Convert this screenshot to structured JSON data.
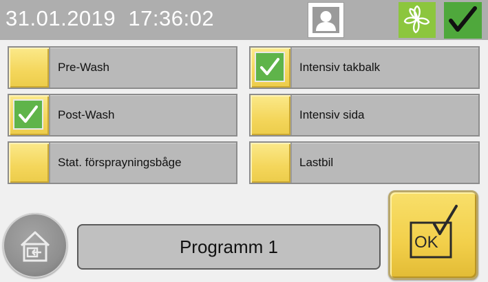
{
  "header": {
    "date": "31.01.2019",
    "time": "17:36:02",
    "user_icon": "user-icon",
    "logo_icon": "flower-logo-icon",
    "status_icon": "checkmark-icon"
  },
  "options": [
    {
      "label": "Pre-Wash",
      "checked": false
    },
    {
      "label": "Post-Wash",
      "checked": true
    },
    {
      "label": "Stat. försprayningsbåge",
      "checked": false
    },
    {
      "label": "Intensiv takbalk",
      "checked": true
    },
    {
      "label": "Intensiv sida",
      "checked": false
    },
    {
      "label": "Lastbil",
      "checked": false
    }
  ],
  "program": {
    "name": "Programm 1"
  },
  "ok_button": {
    "label": "OK"
  },
  "colors": {
    "header_bg": "#aeaeae",
    "option_yellow": "#f4d65b",
    "check_green": "#5fb44a",
    "logo_green": "#8cc63e",
    "status_green": "#4fa83c"
  }
}
